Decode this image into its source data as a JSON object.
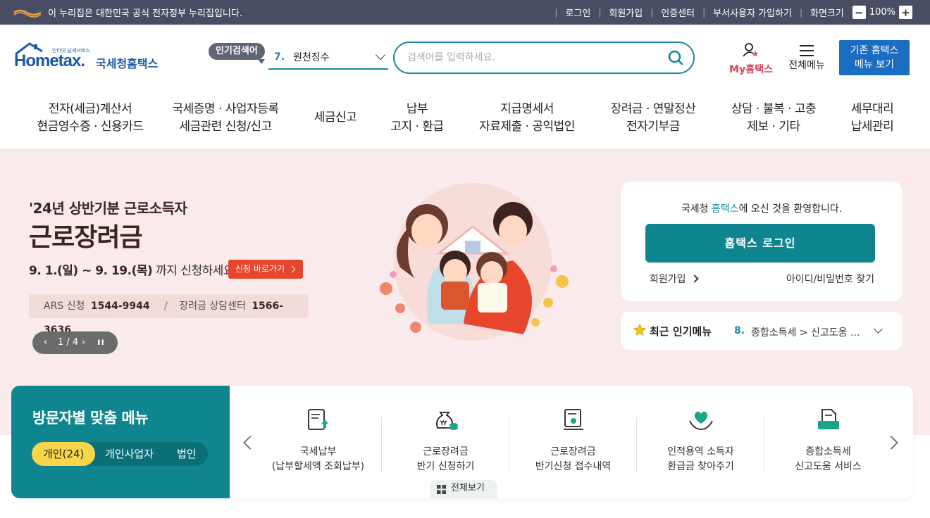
{
  "gov_bar": {
    "notice": "이 누리집은 대한민국 공식 전자정부 누리집입니다.",
    "links": [
      "로그인",
      "회원가입",
      "인증센터",
      "부서사용자 가입하기",
      "화면크기"
    ],
    "zoom_level": "100%",
    "zoom_minus": "−",
    "zoom_plus": "+"
  },
  "header": {
    "logo_text": "Hometax.",
    "logo_sub": "인터넷 납세서비스",
    "logo_kr": "국세청홈택스",
    "popular_label": "인기검색어",
    "popular_rank": "7.",
    "popular_term": "원천징수",
    "search_placeholder": "검색어를 입력하세요.",
    "my_label": "My홈택스",
    "allmenu_label": "전체메뉴",
    "oldmenu_line1": "기존 홈택스",
    "oldmenu_line2": "메뉴 보기"
  },
  "nav": [
    {
      "line1": "전자(세금)계산서",
      "line2": "현금영수증 · 신용카드"
    },
    {
      "line1": "국세증명 · 사업자등록",
      "line2": "세금관련 신청/신고"
    },
    {
      "line1": "세금신고",
      "line2": ""
    },
    {
      "line1": "납부",
      "line2": "고지 · 환급"
    },
    {
      "line1": "지급명세서",
      "line2": "자료제출 · 공익법인"
    },
    {
      "line1": "장려금 · 연말정산",
      "line2": "전자기부금"
    },
    {
      "line1": "상담 · 불복 · 고충",
      "line2": "제보 · 기타"
    },
    {
      "line1": "세무대리",
      "line2": "납세관리"
    }
  ],
  "hero": {
    "subtitle": "'24년 상반기분 근로소득자",
    "title": "근로장려금",
    "date_range": "9. 1.(일) ~ 9. 19.(목)",
    "date_suffix": " 까지 신청하세요!",
    "apply_button": "신청 바로가기",
    "ars_label": "ARS 신청",
    "ars_number": "1544-9944",
    "ars_sep": "/",
    "center_label": "장려금 상담센터",
    "center_number": "1566-3636",
    "pager_text": "1 / 4"
  },
  "login_card": {
    "welcome_prefix": "국세청 ",
    "welcome_highlight": "홈택스",
    "welcome_suffix": "에 오신 것을 환영합니다.",
    "login_button": "홈택스 로그인",
    "join_link": "회원가입",
    "find_link": "아이디/비밀번호 찾기"
  },
  "recent_menu": {
    "title": "최근 인기메뉴",
    "rank": "8.",
    "value": "종합소득세 > 신고도움 ..."
  },
  "visitor": {
    "title": "방문자별 맞춤 메뉴",
    "tabs": [
      "개인(24)",
      "개인사업자",
      "법인"
    ],
    "items": [
      {
        "icon": "tax-payment-document-icon",
        "line1": "국세납부",
        "line2": "(납부할세액 조회납부)"
      },
      {
        "icon": "money-bag-coin-icon",
        "line1": "근로장려금",
        "line2": "반기 신청하기"
      },
      {
        "icon": "monitor-scroll-icon",
        "line1": "근로장려금",
        "line2": "반기신청 접수내역"
      },
      {
        "icon": "heart-hands-icon",
        "line1": "인적용역 소득자",
        "line2": "환급금 찾아주기"
      },
      {
        "icon": "document-tray-icon",
        "line1": "종합소득세",
        "line2": "신고도움 서비스"
      }
    ],
    "view_all": "전체보기"
  },
  "colors": {
    "gov_bar": "#4a4e64",
    "teal": "#0f868f",
    "brand_blue": "#1b5aa6",
    "hero_bg": "#f9ebeb",
    "accent_red": "#e8452d",
    "tab_yellow": "#f7d64a"
  }
}
